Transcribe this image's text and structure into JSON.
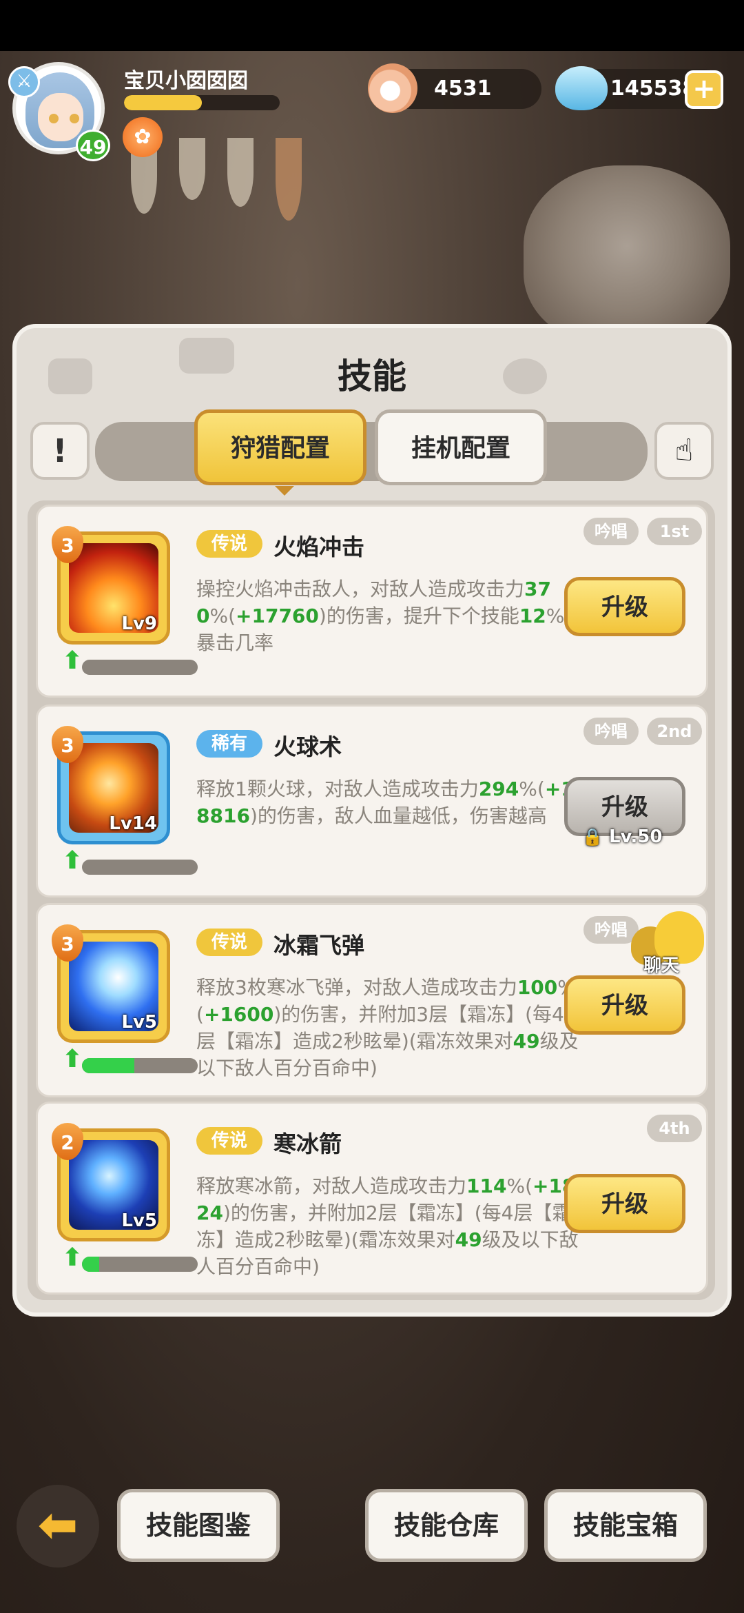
{
  "header": {
    "player_name": "宝贝小囡囡囡",
    "level": "49",
    "exp_progress": 0.5,
    "pearls": "4531",
    "diamonds": "145538",
    "plus_label": "+"
  },
  "panel": {
    "title": "技能",
    "info_label": "!",
    "tabs": [
      {
        "label": "狩猎配置",
        "active": true
      },
      {
        "label": "挂机配置",
        "active": false
      }
    ]
  },
  "skills": [
    {
      "stars": "3",
      "lv": "Lv9",
      "rarity": "传说",
      "name": "火焰冲击",
      "desc": [
        "操控火焰冲击敌人，对敌人造成攻击力",
        "370",
        "%(",
        "+17760",
        ")的伤害，提升下个技能",
        "12",
        "%暴击几率"
      ],
      "tags": [
        "吟唱",
        "1st"
      ],
      "progress": 0.0,
      "button": "升级",
      "locked": false
    },
    {
      "stars": "3",
      "lv": "Lv14",
      "rarity": "稀有",
      "name": "火球术",
      "desc": [
        "释放1颗火球，对敌人造成攻击力",
        "294",
        "%(",
        "+18816",
        ")的伤害，敌人血量越低，伤害越高"
      ],
      "tags": [
        "吟唱",
        "2nd"
      ],
      "progress": 0.0,
      "button": "升级",
      "locked": true,
      "lock_label": "Lv.50"
    },
    {
      "stars": "3",
      "lv": "Lv5",
      "rarity": "传说",
      "name": "冰霜飞弹",
      "desc": [
        "释放3枚寒冰飞弹，对敌人造成攻击力",
        "100",
        "%(",
        "+1600",
        ")的伤害，并附加3层【霜冻】(每4层【霜冻】造成2秒眩晕)(霜冻效果对",
        "49",
        "级及以下敌人百分百命中)"
      ],
      "tags": [
        "吟唱"
      ],
      "progress": 0.45,
      "button": "升级",
      "locked": false
    },
    {
      "stars": "2",
      "lv": "Lv5",
      "rarity": "传说",
      "name": "寒冰箭",
      "desc": [
        "释放寒冰箭，对敌人造成攻击力",
        "114",
        "%(",
        "+1824",
        ")的伤害，并附加2层【霜冻】(每4层【霜冻】造成2秒眩晕)(霜冻效果对",
        "49",
        "级及以下敌人百分百命中)"
      ],
      "tags": [
        "4th"
      ],
      "progress": 0.15,
      "button": "升级",
      "locked": false
    }
  ],
  "chat": {
    "label": "聊天"
  },
  "bottom": {
    "back_icon": "back-arrow-icon",
    "buttons": [
      "技能图鉴",
      "技能仓库",
      "技能宝箱"
    ]
  },
  "colors": {
    "accent_gold": "#f0c63c",
    "rare_blue": "#5cb3ec",
    "highlight_green": "#2ba12f"
  }
}
